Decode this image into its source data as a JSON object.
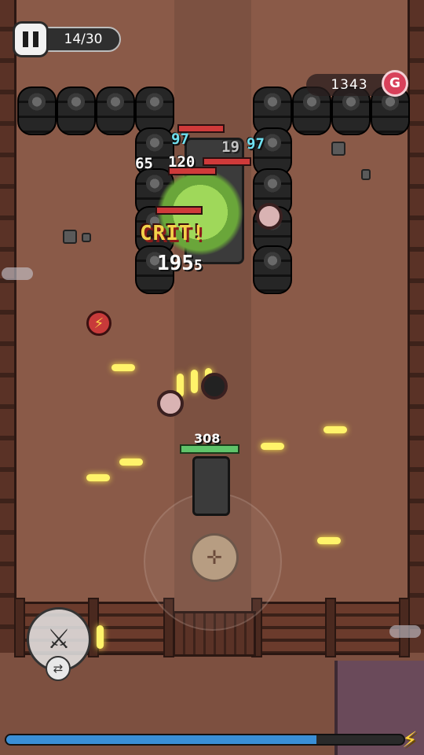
{
  "hud": {
    "wave_label": "14/30",
    "gold_amount": "1343",
    "gold_icon_letter": "G",
    "pause_icon": "pause-icon",
    "weapon_icon": "spear-icon",
    "swap_icon": "swap-icon",
    "energy_icon": "lightning-icon"
  },
  "combat": {
    "crit_label": "CRIT!",
    "crit_damage": "195",
    "crit_suffix": "5",
    "damage_numbers": [
      "97",
      "97",
      "65",
      "120",
      "19"
    ],
    "player_hp": "308"
  },
  "progress": {
    "xp_fraction": 0.78
  },
  "colors": {
    "ground": "#8a5a48",
    "bullet": "#fff36a",
    "crit_text": "#f2d24a",
    "damage_cyan": "#6fe0f0",
    "gold_badge": "#d8405a",
    "xp_fill": "#3a8fd6",
    "player_hp": "#5fc46a"
  }
}
